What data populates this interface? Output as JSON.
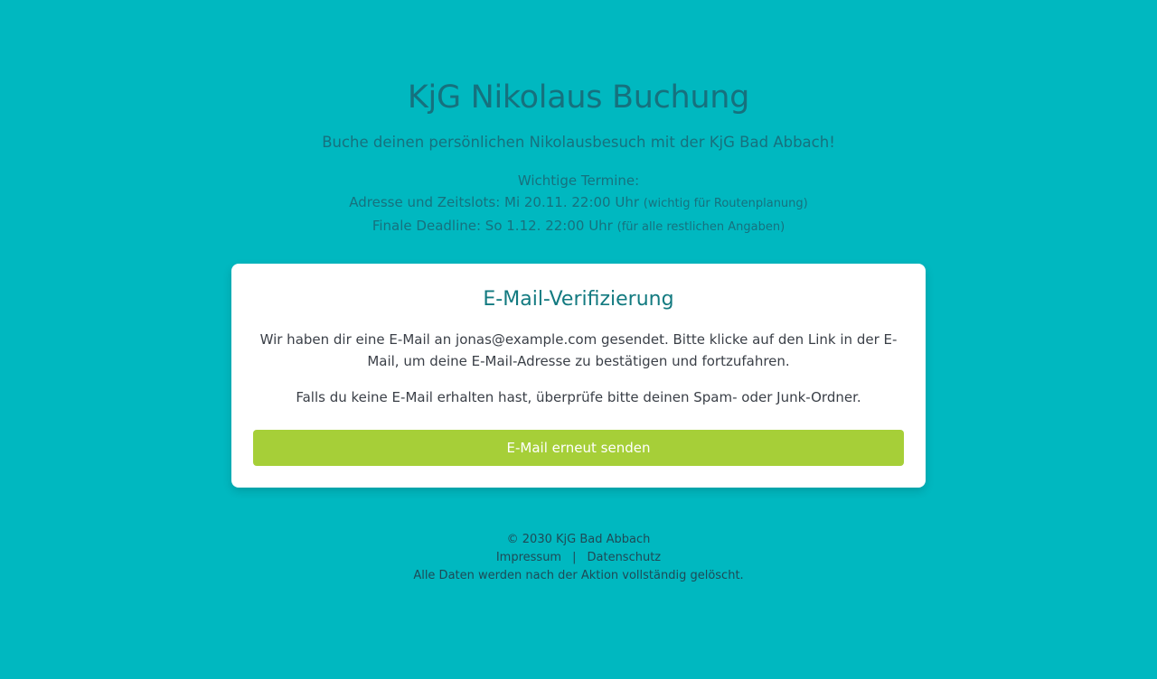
{
  "header": {
    "title": "KjG Nikolaus Buchung",
    "subtitle": "Buche deinen persönlichen Nikolausbesuch mit der KjG Bad Abbach!",
    "dates_heading": "Wichtige Termine:",
    "date1_main": "Adresse und Zeitslots: Mi 20.11. 22:00 Uhr",
    "date1_note": "(wichtig für Routenplanung)",
    "date2_main": "Finale Deadline: So 1.12. 22:00 Uhr",
    "date2_note": "(für alle restlichen Angaben)"
  },
  "card": {
    "title": "E-Mail-Verifizierung",
    "text1": "Wir haben dir eine E-Mail an jonas@example.com gesendet. Bitte klicke auf den Link in der E-Mail, um deine E-Mail-Adresse zu bestätigen und fortzufahren.",
    "text2": "Falls du keine E-Mail erhalten hast, überprüfe bitte deinen Spam- oder Junk-Ordner.",
    "button_label": "E-Mail erneut senden"
  },
  "footer": {
    "copyright": "© 2030 KjG Bad Abbach",
    "impressum": "Impressum",
    "separator": "|",
    "datenschutz": "Datenschutz",
    "note": "Alle Daten werden nach der Aktion vollständig gelöscht."
  },
  "colors": {
    "background": "#00b8c0",
    "header_text": "#16717e",
    "card_title": "#137a80",
    "button": "#a6cf38"
  }
}
